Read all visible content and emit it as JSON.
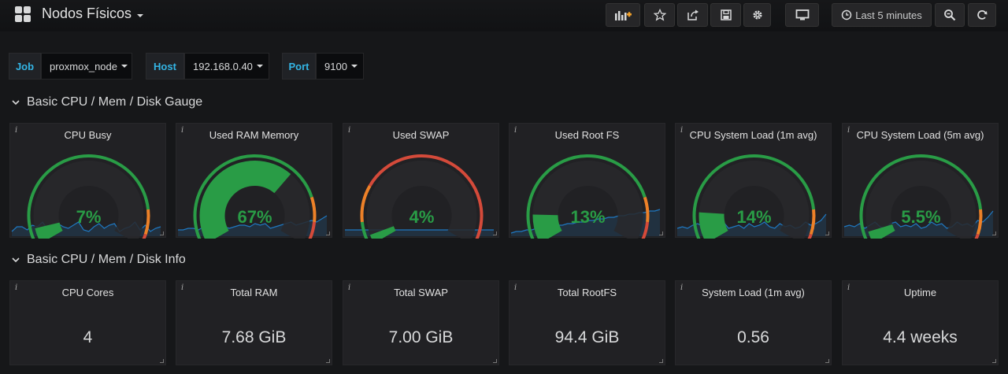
{
  "header": {
    "title": "Nodos Físicos",
    "time_range": "Last 5 minutes"
  },
  "variables": [
    {
      "label": "Job",
      "value": "proxmox_node"
    },
    {
      "label": "Host",
      "value": "192.168.0.40"
    },
    {
      "label": "Port",
      "value": "9100"
    }
  ],
  "rows": [
    {
      "title": "Basic CPU / Mem / Disk Gauge"
    },
    {
      "title": "Basic CPU / Mem / Disk Info"
    }
  ],
  "gauges": [
    {
      "title": "CPU Busy",
      "value": "7%",
      "percent": 7,
      "thresholds": [
        85,
        95
      ],
      "spark": [
        3,
        6,
        6,
        4,
        7,
        6,
        9,
        4,
        3,
        8,
        6,
        5,
        7,
        9,
        4,
        3,
        6,
        8,
        5,
        7,
        8,
        3,
        5,
        6,
        9,
        4,
        7,
        3,
        5,
        6
      ]
    },
    {
      "title": "Used RAM Memory",
      "value": "67%",
      "percent": 67,
      "thresholds": [
        80,
        90
      ],
      "spark": [
        4,
        4,
        5,
        5,
        4,
        6,
        6,
        5,
        7,
        6,
        5,
        6,
        7,
        7,
        6,
        8,
        7,
        8,
        5,
        6,
        7,
        8,
        9,
        7,
        8,
        9,
        10,
        9,
        11,
        13
      ]
    },
    {
      "title": "Used SWAP",
      "value": "4%",
      "percent": 4,
      "thresholds": [
        10,
        25
      ],
      "spark": [
        4,
        4,
        4,
        4,
        4,
        4,
        4,
        4,
        4,
        4,
        4,
        4,
        4,
        4,
        4,
        4,
        4,
        4,
        4,
        4,
        4,
        4,
        4,
        4,
        4,
        4,
        4,
        4,
        4,
        4
      ]
    },
    {
      "title": "Used Root FS",
      "value": "13%",
      "percent": 13,
      "thresholds": [
        80,
        90
      ],
      "spark": [
        2,
        3,
        3,
        4,
        4,
        5,
        5,
        6,
        6,
        7,
        7,
        8,
        8,
        9,
        9,
        10,
        10,
        11,
        11,
        12,
        12,
        13,
        13,
        14,
        14,
        15,
        15,
        16,
        16,
        17
      ]
    },
    {
      "title": "CPU System Load (1m avg)",
      "value": "14%",
      "percent": 14,
      "thresholds": [
        85,
        95
      ],
      "spark": [
        5,
        6,
        5,
        7,
        8,
        6,
        5,
        7,
        6,
        9,
        5,
        6,
        7,
        5,
        8,
        6,
        7,
        9,
        6,
        5,
        8,
        6,
        7,
        5,
        6,
        9,
        7,
        8,
        10,
        14
      ]
    },
    {
      "title": "CPU System Load (5m avg)",
      "value": "5.5%",
      "percent": 5.5,
      "thresholds": [
        85,
        95
      ],
      "spark": [
        6,
        7,
        6,
        8,
        5,
        7,
        9,
        6,
        5,
        8,
        9,
        6,
        7,
        6,
        8,
        5,
        6,
        9,
        7,
        8,
        5,
        6,
        9,
        7,
        8,
        6,
        10,
        9,
        12,
        16
      ]
    }
  ],
  "stats": [
    {
      "title": "CPU Cores",
      "value": "4"
    },
    {
      "title": "Total RAM",
      "value": "7.68 GiB"
    },
    {
      "title": "Total SWAP",
      "value": "7.00 GiB"
    },
    {
      "title": "Total RootFS",
      "value": "94.4 GiB"
    },
    {
      "title": "System Load (1m avg)",
      "value": "0.56"
    },
    {
      "title": "Uptime",
      "value": "4.4 weeks"
    }
  ],
  "colors": {
    "ok": "#299c46",
    "warn": "#ed8128",
    "crit": "#d44a3a",
    "accent": "#33b5e5",
    "spark_line": "#1f78c1"
  }
}
